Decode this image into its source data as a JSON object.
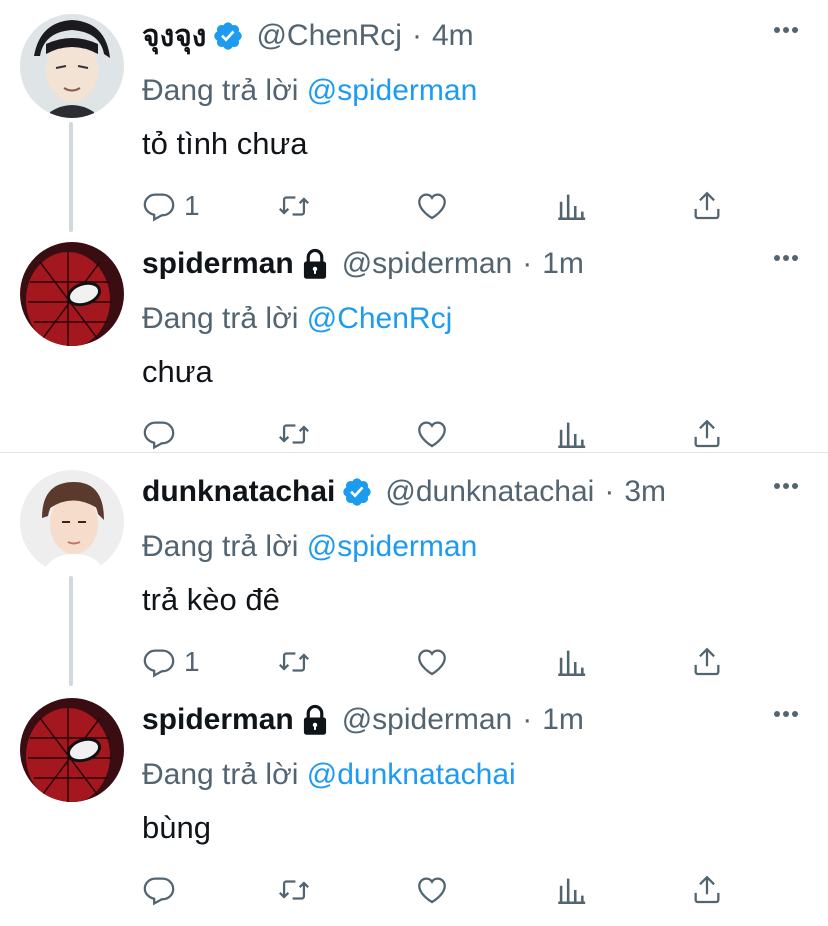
{
  "thread": {
    "reply_prefix": "Đang trả lời"
  },
  "tweets": [
    {
      "name": "จุงจุง",
      "verified": true,
      "handle": "@ChenRcj",
      "dot": "·",
      "time": "4m",
      "reply_to": "@spiderman",
      "text": "tỏ tình chưa",
      "reply_count": "1"
    },
    {
      "name": "spiderman",
      "locked": true,
      "handle": "@spiderman",
      "dot": "·",
      "time": "1m",
      "reply_to": "@ChenRcj",
      "text": "chưa",
      "reply_count": ""
    },
    {
      "name": "dunknatachai",
      "verified": true,
      "handle": "@dunknatachai",
      "dot": "·",
      "time": "3m",
      "reply_to": "@spiderman",
      "text": "trả kèo đê",
      "reply_count": "1"
    },
    {
      "name": "spiderman",
      "locked": true,
      "handle": "@spiderman",
      "dot": "·",
      "time": "1m",
      "reply_to": "@dunknatachai",
      "text": "bùng",
      "reply_count": ""
    }
  ],
  "colors": {
    "accent": "#1d9bf0",
    "secondary_text": "#536471",
    "thread_line": "#cfd9de"
  },
  "icons": {
    "reply": "reply-icon",
    "retweet": "retweet-icon",
    "like": "heart-icon",
    "analytics": "analytics-icon",
    "share": "share-icon",
    "more": "more-icon",
    "verified": "verified-badge-icon",
    "locked": "lock-icon"
  }
}
